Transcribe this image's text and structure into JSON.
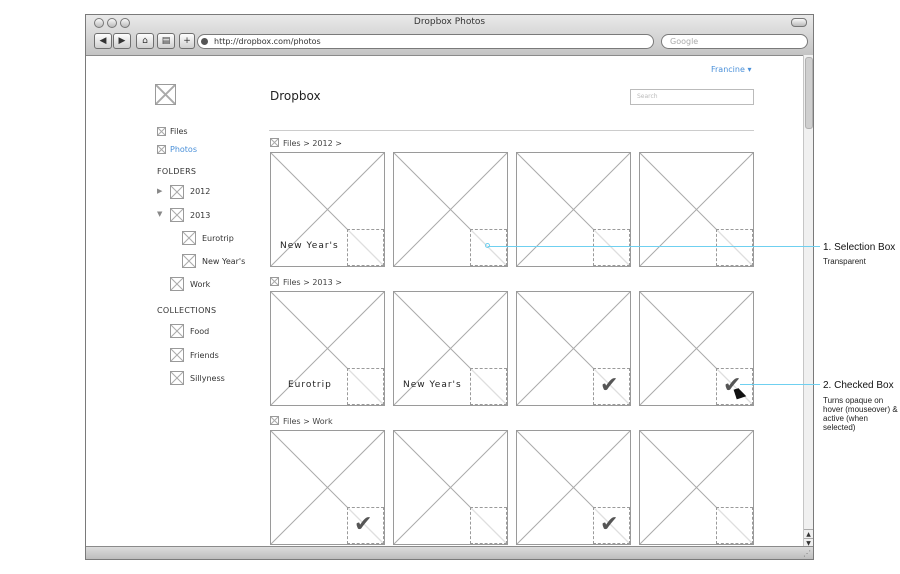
{
  "window": {
    "title": "Dropbox Photos",
    "url": "http://dropbox.com/photos",
    "search_placeholder": "Google"
  },
  "header": {
    "user_menu": "Francine",
    "user_menu_caret": "▾",
    "app_title": "Dropbox",
    "search_placeholder": "Search"
  },
  "sidebar": {
    "nav": [
      "Files",
      "Photos"
    ],
    "folders_heading": "FOLDERS",
    "folders": [
      {
        "label": "2012",
        "toggle": "▶"
      },
      {
        "label": "2013",
        "toggle": "▼"
      },
      {
        "label": "Eurotrip"
      },
      {
        "label": "New Year's"
      },
      {
        "label": "Work"
      }
    ],
    "collections_heading": "COLLECTIONS",
    "collections": [
      "Food",
      "Friends",
      "Sillyness"
    ]
  },
  "sections": [
    {
      "breadcrumb": "Files > 2012 >",
      "tiles": [
        {
          "caption": "New Year's",
          "checked": false
        },
        {
          "caption": "",
          "checked": false,
          "hover": true
        },
        {
          "caption": "",
          "checked": false
        },
        {
          "caption": "",
          "checked": false
        }
      ]
    },
    {
      "breadcrumb": "Files > 2013 >",
      "tiles": [
        {
          "caption": "Eurotrip",
          "checked": false
        },
        {
          "caption": "New Year's",
          "checked": false
        },
        {
          "caption": "",
          "checked": true
        },
        {
          "caption": "",
          "checked": true,
          "hover": true
        }
      ]
    },
    {
      "breadcrumb": "Files > Work",
      "tiles": [
        {
          "caption": "",
          "checked": true
        },
        {
          "caption": "",
          "checked": false
        },
        {
          "caption": "",
          "checked": true
        },
        {
          "caption": "",
          "checked": false
        }
      ]
    }
  ],
  "annotations": [
    {
      "title": "1. Selection Box",
      "desc": "Transparent"
    },
    {
      "title": "2. Checked Box",
      "desc": "Turns opaque on hover (mouseover) & active (when selected)"
    }
  ],
  "colors": {
    "link": "#4a90d9",
    "annotation_line": "#6fd0f0",
    "check": "#555555"
  },
  "icons": {
    "check": "✔",
    "cursor": "cursor-arrow-icon"
  }
}
